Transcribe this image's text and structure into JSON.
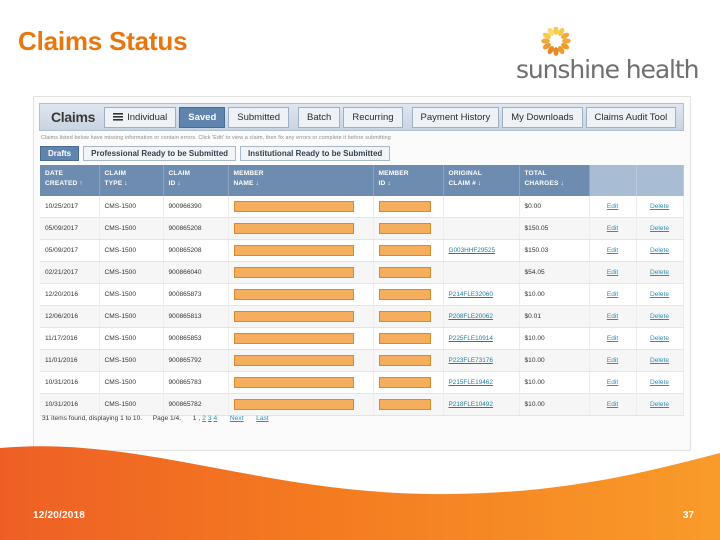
{
  "slide": {
    "title": "Claims Status",
    "date": "12/20/2018",
    "page_number": "37",
    "accent_color": "#E8760E"
  },
  "logo": {
    "brand": "sunshine health",
    "mark": "sunburst-icon"
  },
  "app": {
    "section_label": "Claims",
    "tabs": [
      {
        "label": "Individual",
        "icon": "hamburger-icon",
        "selected": false
      },
      {
        "label": "Saved",
        "selected": true
      },
      {
        "label": "Submitted",
        "selected": false
      },
      {
        "label": "Batch",
        "selected": false
      },
      {
        "label": "Recurring",
        "selected": false
      },
      {
        "label": "Payment History",
        "selected": false
      },
      {
        "label": "My Downloads",
        "selected": false
      },
      {
        "label": "Claims Audit Tool",
        "selected": false
      }
    ],
    "info_text": "Claims listed below have missing information or contain errors. Click 'Edit' to view a claim, then fix any errors or complete it before submitting",
    "subtabs": [
      {
        "label": "Drafts",
        "selected": true
      },
      {
        "label": "Professional Ready to be Submitted",
        "selected": false
      },
      {
        "label": "Institutional Ready to be Submitted",
        "selected": false
      }
    ],
    "table": {
      "columns": [
        {
          "line1": "DATE",
          "line2": "CREATED ↑"
        },
        {
          "line1": "CLAIM",
          "line2": "TYPE ↓"
        },
        {
          "line1": "CLAIM",
          "line2": "ID ↓"
        },
        {
          "line1": "MEMBER",
          "line2": "NAME ↓"
        },
        {
          "line1": "MEMBER",
          "line2": "ID ↓"
        },
        {
          "line1": "ORIGINAL",
          "line2": "CLAIM # ↓"
        },
        {
          "line1": "TOTAL",
          "line2": "CHARGES ↓"
        },
        {
          "line1": "",
          "line2": ""
        },
        {
          "line1": "",
          "line2": ""
        }
      ],
      "rows": [
        {
          "date": "10/25/2017",
          "type": "CMS-1500",
          "claim_id": "900966390",
          "member_name": "redacted",
          "member_id": "redacted",
          "original_claim": "",
          "charges": "$0.00",
          "edit": "Edit",
          "delete": "Delete"
        },
        {
          "date": "05/09/2017",
          "type": "CMS-1500",
          "claim_id": "900865208",
          "member_name": "redacted",
          "member_id": "redacted",
          "original_claim": "",
          "charges": "$150.05",
          "edit": "Edit",
          "delete": "Delete"
        },
        {
          "date": "05/09/2017",
          "type": "CMS-1500",
          "claim_id": "900865208",
          "member_name": "redacted",
          "member_id": "redacted",
          "original_claim": "G003HHF29525",
          "charges": "$150.03",
          "edit": "Edit",
          "delete": "Delete"
        },
        {
          "date": "02/21/2017",
          "type": "CMS-1500",
          "claim_id": "900866040",
          "member_name": "redacted",
          "member_id": "redacted",
          "original_claim": "",
          "charges": "$54.05",
          "edit": "Edit",
          "delete": "Delete"
        },
        {
          "date": "12/20/2016",
          "type": "CMS-1500",
          "claim_id": "900865873",
          "member_name": "redacted",
          "member_id": "redacted",
          "original_claim": "P214FLE32060",
          "charges": "$10.00",
          "edit": "Edit",
          "delete": "Delete"
        },
        {
          "date": "12/06/2016",
          "type": "CMS-1500",
          "claim_id": "900865813",
          "member_name": "redacted",
          "member_id": "redacted",
          "original_claim": "P208FLE20062",
          "charges": "$0.01",
          "edit": "Edit",
          "delete": "Delete"
        },
        {
          "date": "11/17/2016",
          "type": "CMS-1500",
          "claim_id": "900865853",
          "member_name": "redacted",
          "member_id": "redacted",
          "original_claim": "P225FLE10914",
          "charges": "$10.00",
          "edit": "Edit",
          "delete": "Delete"
        },
        {
          "date": "11/01/2016",
          "type": "CMS-1500",
          "claim_id": "900865792",
          "member_name": "redacted",
          "member_id": "redacted",
          "original_claim": "P223FLE73176",
          "charges": "$10.00",
          "edit": "Edit",
          "delete": "Delete"
        },
        {
          "date": "10/31/2016",
          "type": "CMS-1500",
          "claim_id": "900865783",
          "member_name": "redacted",
          "member_id": "redacted",
          "original_claim": "P215FLE19462",
          "charges": "$10.00",
          "edit": "Edit",
          "delete": "Delete"
        },
        {
          "date": "10/31/2016",
          "type": "CMS-1500",
          "claim_id": "900865782",
          "member_name": "redacted",
          "member_id": "redacted",
          "original_claim": "P218FLE10492",
          "charges": "$10.00",
          "edit": "Edit",
          "delete": "Delete"
        }
      ]
    },
    "pager": {
      "summary": "31 items found, displaying 1 to 10.",
      "page_label": "Page 1/4.",
      "current": "1",
      "pages": [
        "2",
        "3",
        "4"
      ],
      "next": "Next",
      "last": "Last"
    }
  }
}
